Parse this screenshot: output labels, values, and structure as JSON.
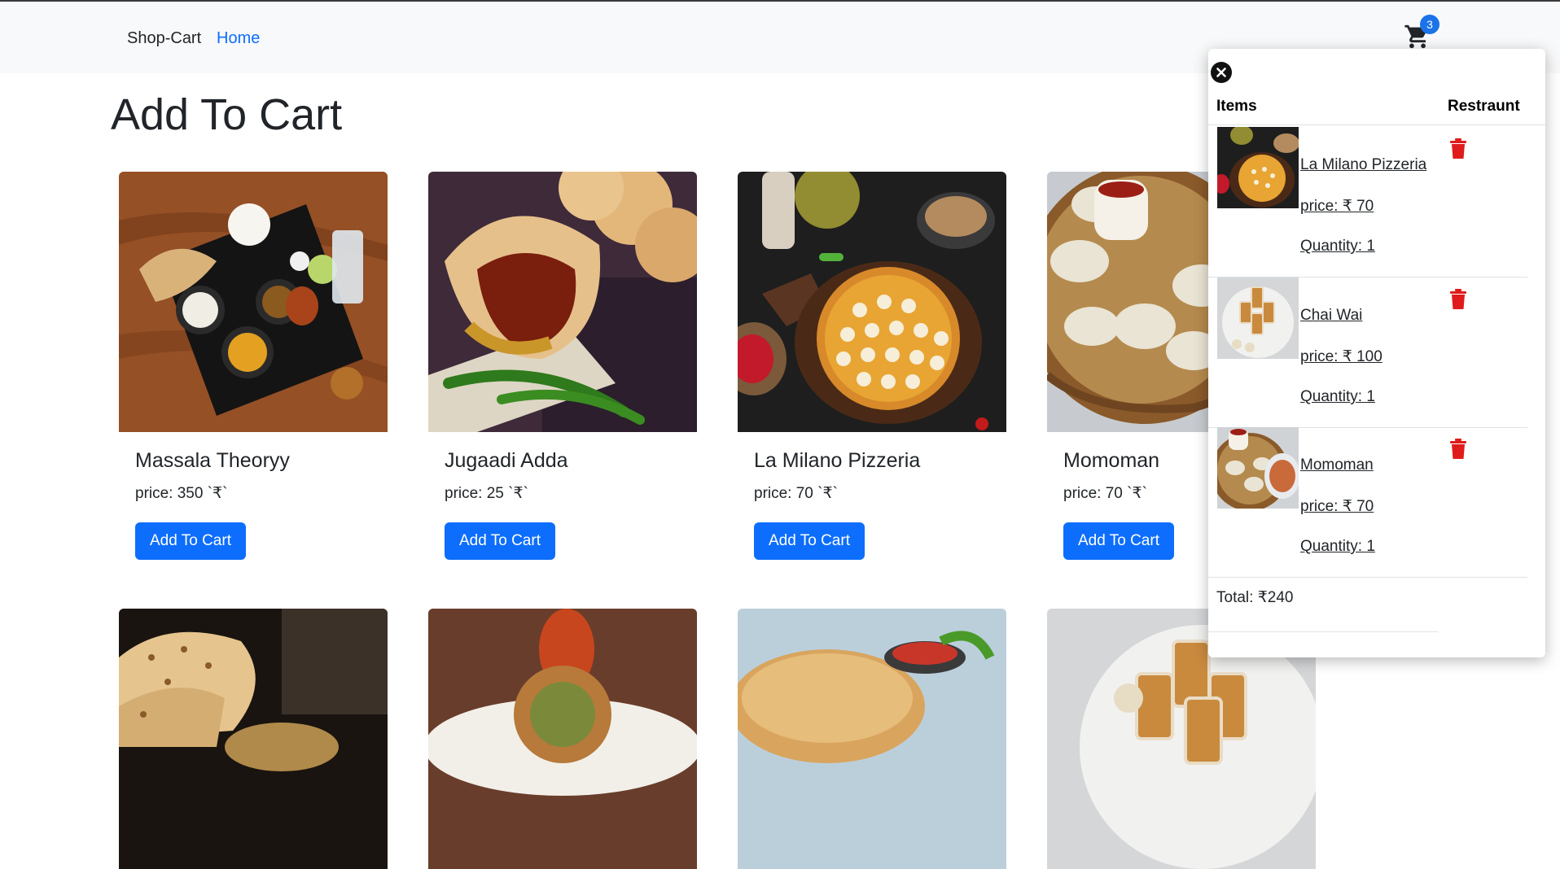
{
  "nav": {
    "brand": "Shop-Cart",
    "home": "Home",
    "cart_count": "3"
  },
  "page_title": "Add To Cart",
  "products": [
    {
      "name": "Massala Theoryy",
      "price": "price: 350 `₹`",
      "button": "Add To Cart",
      "image": "thali"
    },
    {
      "name": "Jugaadi Adda",
      "price": "price: 25 `₹`",
      "button": "Add To Cart",
      "image": "vada-pav"
    },
    {
      "name": "La Milano Pizzeria",
      "price": "price: 70 `₹`",
      "button": "Add To Cart",
      "image": "pizza"
    },
    {
      "name": "Momoman",
      "price": "price: 70 `₹`",
      "button": "Add To Cart",
      "image": "momos"
    }
  ],
  "products_row2": [
    {
      "image": "naan"
    },
    {
      "image": "roll"
    },
    {
      "image": "bhatura"
    },
    {
      "image": "chai"
    }
  ],
  "cart": {
    "headers": {
      "items": "Items",
      "restaurant": "Restraunt"
    },
    "items": [
      {
        "name": "La Milano Pizzeria",
        "price": "price: ₹ 70",
        "quantity": "Quantity: 1",
        "image": "pizza"
      },
      {
        "name": "Chai Wai",
        "price": "price: ₹ 100",
        "quantity": "Quantity: 1",
        "image": "chai"
      },
      {
        "name": "Momoman",
        "price": "price: ₹ 70",
        "quantity": "Quantity: 1",
        "image": "momos"
      }
    ],
    "total": "Total: ₹240"
  },
  "colors": {
    "primary": "#0d6efd",
    "delete": "#e01b1b",
    "navbar_bg": "#f8f9fa",
    "badge": "#1a73e8"
  }
}
